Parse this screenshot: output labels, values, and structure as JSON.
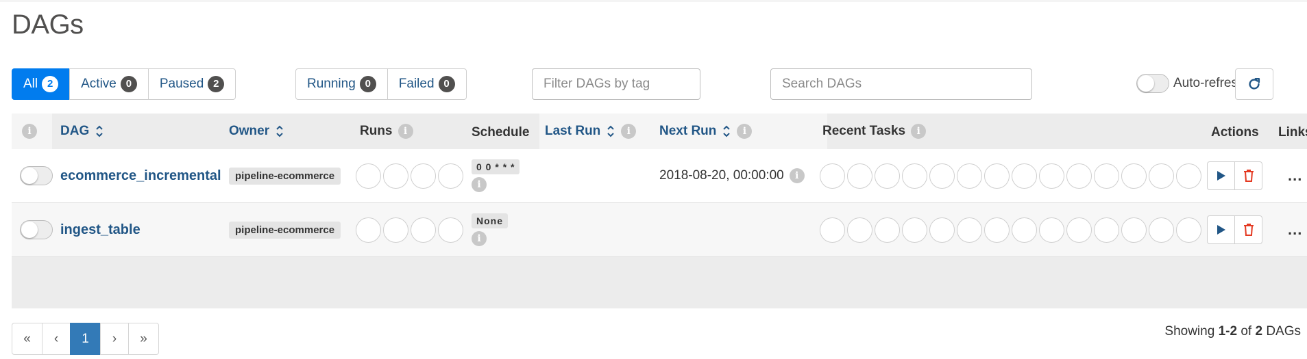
{
  "page": {
    "title": "DAGs"
  },
  "status_filters": [
    {
      "label": "All",
      "count": "2",
      "active": true
    },
    {
      "label": "Active",
      "count": "0",
      "active": false
    },
    {
      "label": "Paused",
      "count": "2",
      "active": false
    }
  ],
  "run_filters": [
    {
      "label": "Running",
      "count": "0"
    },
    {
      "label": "Failed",
      "count": "0"
    }
  ],
  "tag_filter": {
    "placeholder": "Filter DAGs by tag",
    "value": ""
  },
  "search": {
    "placeholder": "Search DAGs",
    "value": ""
  },
  "auto_refresh": {
    "label": "Auto-refresh",
    "enabled": false
  },
  "table": {
    "headers": {
      "dag": "DAG",
      "owner": "Owner",
      "runs": "Runs",
      "schedule": "Schedule",
      "last_run": "Last Run",
      "next_run": "Next Run",
      "recent_tasks": "Recent Tasks",
      "actions": "Actions",
      "links": "Links"
    },
    "rows": [
      {
        "dag_id": "ecommerce_incremental",
        "paused": true,
        "owner": "pipeline-ecommerce",
        "schedule": "0 0 * * *",
        "last_run": "",
        "next_run": "2018-08-20, 00:00:00",
        "run_circles": 4,
        "task_circles": 14
      },
      {
        "dag_id": "ingest_table",
        "paused": true,
        "owner": "pipeline-ecommerce",
        "schedule": "None",
        "last_run": "",
        "next_run": "",
        "run_circles": 4,
        "task_circles": 14
      }
    ],
    "more_actions": "..."
  },
  "pagination": {
    "first": "«",
    "prev": "‹",
    "current": "1",
    "next": "›",
    "last": "»"
  },
  "summary": {
    "prefix": "Showing",
    "range": "1-2",
    "of": "of",
    "total": "2",
    "suffix": "DAGs"
  },
  "colors": {
    "accent": "#017cee",
    "link": "#215686",
    "page_active": "#337ab7",
    "delete": "#e43921"
  },
  "icons": {
    "refresh": "refresh-icon",
    "info": "info-icon",
    "sort": "sort-icon",
    "trigger": "play-icon",
    "delete": "trash-icon",
    "more": "more-icon"
  }
}
